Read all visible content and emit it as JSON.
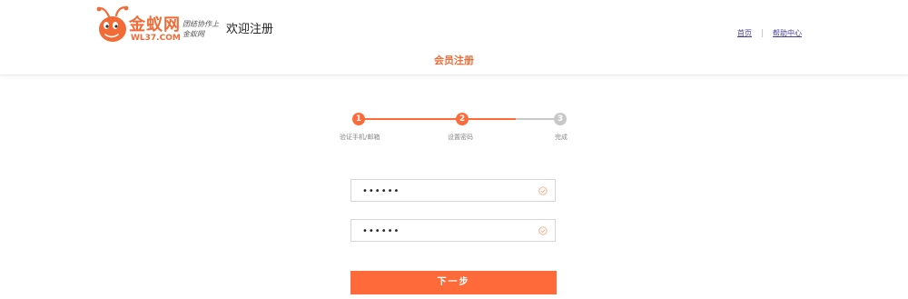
{
  "header": {
    "logo_text": "金蚁网",
    "logo_domain": "WL37.COM",
    "slogan": "团结协作上金蚁网",
    "welcome": "欢迎注册",
    "nav": [
      {
        "label": "首页"
      },
      {
        "label": "帮助中心"
      }
    ]
  },
  "page": {
    "title": "会员注册"
  },
  "steps": [
    {
      "number": "1",
      "label": "验证手机/邮箱",
      "state": "done"
    },
    {
      "number": "2",
      "label": "设置密码",
      "state": "active"
    },
    {
      "number": "3",
      "label": "完成",
      "state": "pending"
    }
  ],
  "form": {
    "password": "••••••",
    "confirm_password": "••••••",
    "next_label": "下一步"
  },
  "colors": {
    "accent": "#ff6a3a",
    "inactive": "#c8c8c8"
  },
  "icons": {
    "logo": "ant-mascot-icon",
    "field_status": "check-circle-icon"
  }
}
